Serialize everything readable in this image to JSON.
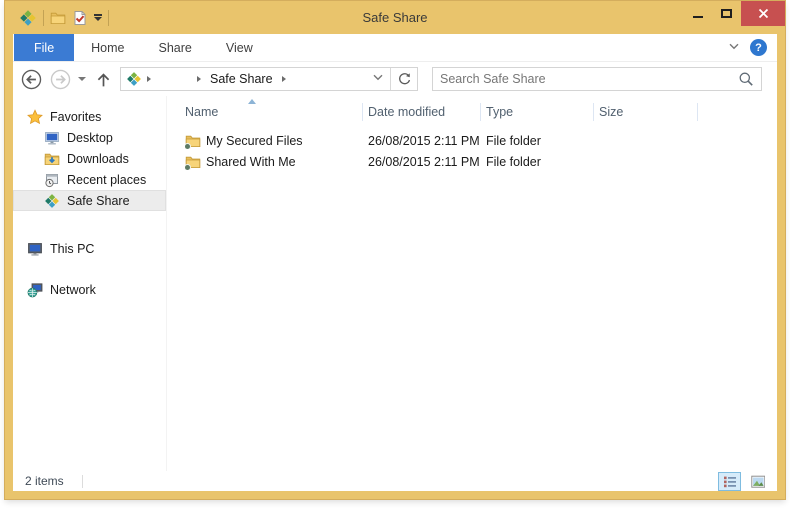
{
  "window": {
    "title": "Safe Share",
    "controls": {
      "minimize": "minimize",
      "maximize": "maximize",
      "close": "close"
    }
  },
  "quick_access": {
    "icons": [
      "safe-share-logo-icon",
      "new-folder-icon",
      "properties-check-icon",
      "customize-toolbar-caret-icon"
    ]
  },
  "ribbon": {
    "tabs": [
      {
        "label": "File",
        "active": true
      },
      {
        "label": "Home",
        "active": false
      },
      {
        "label": "Share",
        "active": false
      },
      {
        "label": "View",
        "active": false
      }
    ],
    "help_label": "?",
    "icons": [
      "minimize-ribbon-chevron-icon",
      "help-icon"
    ]
  },
  "navbar": {
    "buttons": [
      "back",
      "forward",
      "history-dropdown",
      "up"
    ],
    "breadcrumb": {
      "root_icon": "safe-share-logo-icon",
      "path": [
        "Safe Share"
      ]
    },
    "refresh_icon": "refresh-icon",
    "search": {
      "placeholder": "Search Safe Share",
      "icon": "search-icon"
    }
  },
  "sidebar": {
    "items": [
      {
        "label": "Favorites",
        "icon": "star-icon",
        "level": 0,
        "selected": false
      },
      {
        "label": "Desktop",
        "icon": "desktop-icon",
        "level": 1,
        "selected": false
      },
      {
        "label": "Downloads",
        "icon": "downloads-icon",
        "level": 1,
        "selected": false
      },
      {
        "label": "Recent places",
        "icon": "recent-places-icon",
        "level": 1,
        "selected": false
      },
      {
        "label": "Safe Share",
        "icon": "safe-share-logo-icon",
        "level": 1,
        "selected": true
      },
      {
        "label": "This PC",
        "icon": "this-pc-icon",
        "level": 0,
        "selected": false
      },
      {
        "label": "Network",
        "icon": "network-icon",
        "level": 0,
        "selected": false
      }
    ]
  },
  "file_list": {
    "columns": [
      {
        "label": "Name",
        "sorted": "ascending"
      },
      {
        "label": "Date modified",
        "sorted": null
      },
      {
        "label": "Type",
        "sorted": null
      },
      {
        "label": "Size",
        "sorted": null
      }
    ],
    "rows": [
      {
        "icon": "folder-icon",
        "name": "My Secured Files",
        "date_modified": "26/08/2015 2:11 PM",
        "type": "File folder",
        "size": ""
      },
      {
        "icon": "folder-icon",
        "name": "Shared With Me",
        "date_modified": "26/08/2015 2:11 PM",
        "type": "File folder",
        "size": ""
      }
    ]
  },
  "statusbar": {
    "item_count": "2 items",
    "view_toggles": [
      "details-view",
      "thumbnails-view"
    ],
    "selected_view": "details-view"
  },
  "colors": {
    "window_chrome": "#e9c46c",
    "file_tab_blue": "#3b7bd3",
    "close_button_red": "#c75050",
    "selected_item_bg": "#ececec",
    "view_toggle_selected_bg": "#d6ebfa",
    "view_toggle_selected_border": "#7fbce0"
  }
}
